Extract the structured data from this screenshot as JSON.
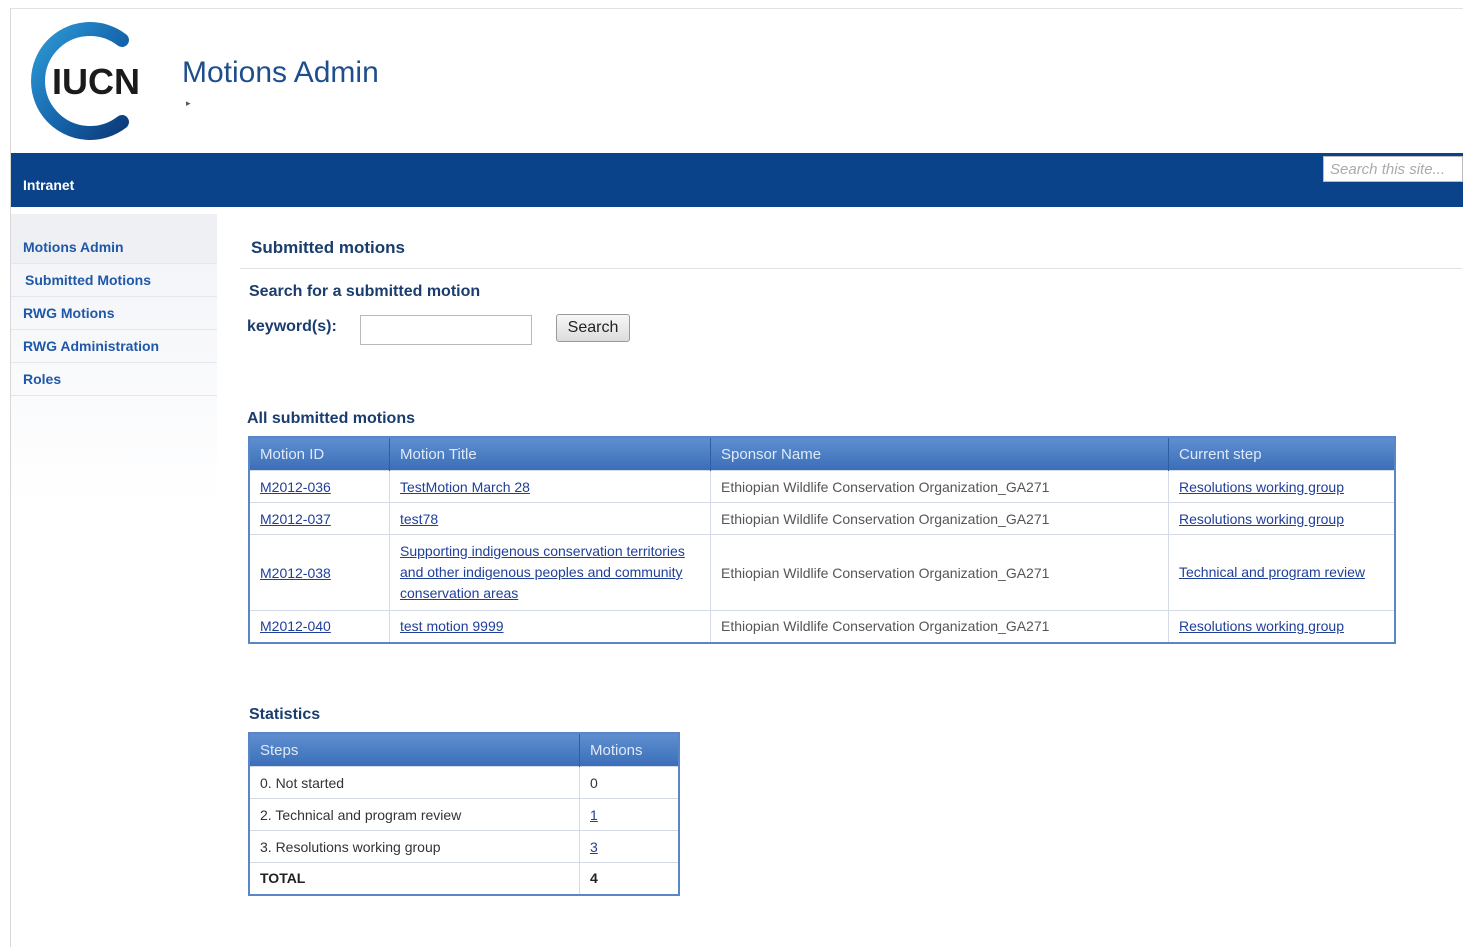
{
  "logo": {
    "text": "IUCN"
  },
  "header": {
    "title": "Motions Admin",
    "crumb_arrow": "▸"
  },
  "topbar": {
    "label": "Intranet",
    "search_placeholder": "Search this site..."
  },
  "sidebar": {
    "items": [
      {
        "label": "Motions Admin"
      },
      {
        "label": "Submitted Motions"
      },
      {
        "label": "RWG Motions"
      },
      {
        "label": "RWG Administration"
      },
      {
        "label": "Roles"
      }
    ]
  },
  "main": {
    "heading": "Submitted motions",
    "search_heading": "Search for a submitted motion",
    "keyword_label": "keyword(s):",
    "keyword_value": "",
    "search_button": "Search",
    "all_heading": "All submitted motions",
    "stats_heading": "Statistics"
  },
  "motions_table": {
    "headers": [
      "Motion ID",
      "Motion Title",
      "Sponsor Name",
      "Current step"
    ],
    "rows": [
      {
        "id": "M2012-036",
        "title": "TestMotion March 28",
        "sponsor": "Ethiopian Wildlife Conservation Organization_GA271",
        "step": "Resolutions working group"
      },
      {
        "id": "M2012-037",
        "title": "test78",
        "sponsor": "Ethiopian Wildlife Conservation Organization_GA271",
        "step": "Resolutions working group"
      },
      {
        "id": "M2012-038",
        "title": "Supporting indigenous conservation territories and other indigenous peoples and community conservation areas",
        "sponsor": "Ethiopian Wildlife Conservation Organization_GA271",
        "step": "Technical and program review"
      },
      {
        "id": "M2012-040",
        "title": "test motion 9999",
        "sponsor": "Ethiopian Wildlife Conservation Organization_GA271",
        "step": "Resolutions working group"
      }
    ]
  },
  "stats_table": {
    "headers": [
      "Steps",
      "Motions"
    ],
    "rows": [
      {
        "step": "0. Not started",
        "count": "0"
      },
      {
        "step": "2. Technical and program review",
        "count": "1"
      },
      {
        "step": "3. Resolutions working group",
        "count": "3"
      }
    ],
    "total_label": "TOTAL",
    "total_count": "4"
  },
  "colors": {
    "brand_blue": "#0a4389",
    "header_blue": "#3b6fb8",
    "logo_arc": "#1a6fb5"
  }
}
